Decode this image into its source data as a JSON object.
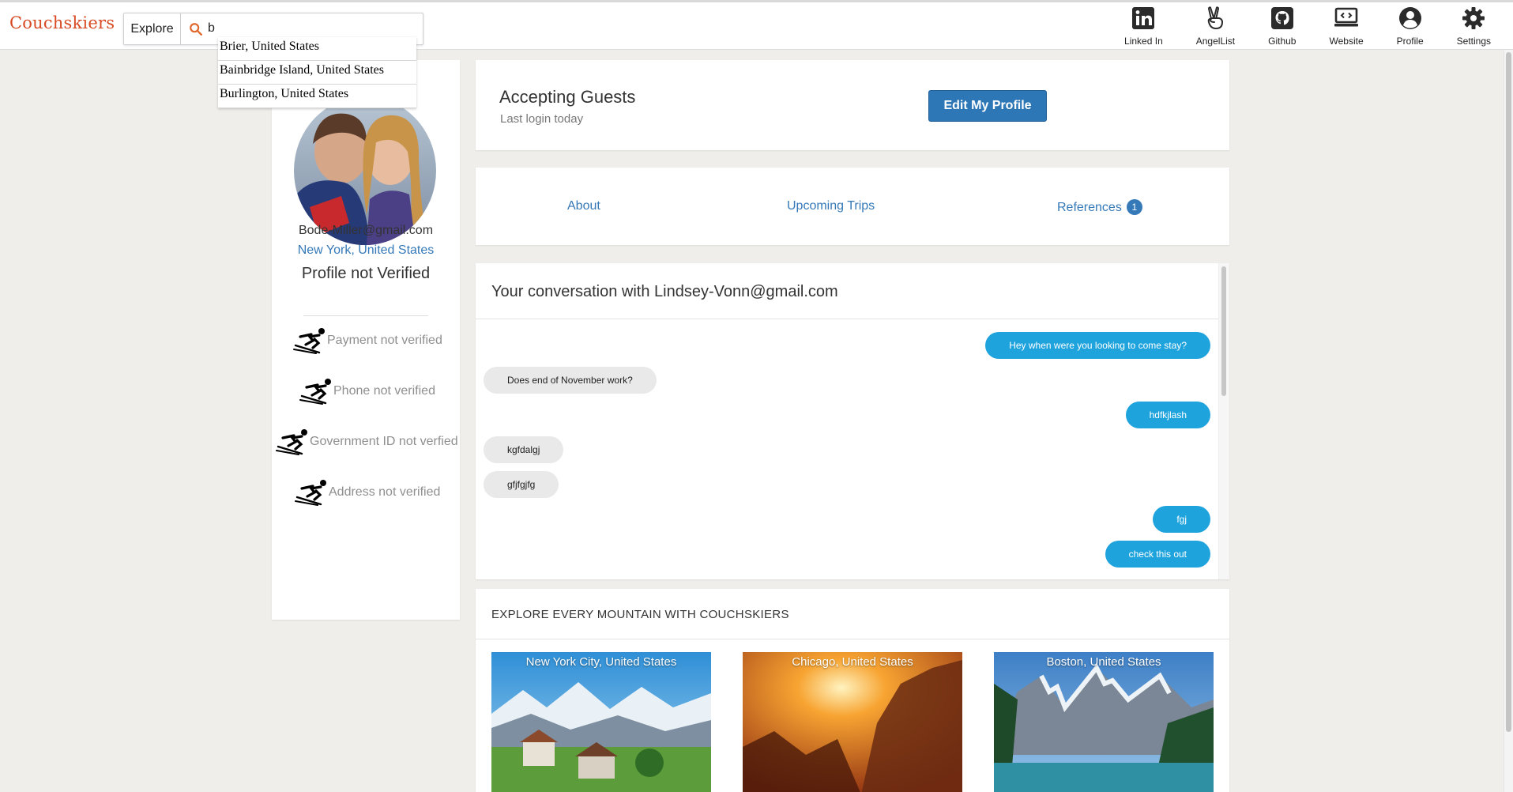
{
  "app": {
    "logo": "Couchskiers"
  },
  "search": {
    "explore_label": "Explore",
    "value": "b",
    "suggestions": [
      "Brier, United States",
      "Bainbridge Island, United States",
      "Burlington, United States"
    ]
  },
  "nav": {
    "items": [
      {
        "label": "Linked In",
        "icon": "linkedin-icon"
      },
      {
        "label": "AngelList",
        "icon": "angellist-icon"
      },
      {
        "label": "Github",
        "icon": "github-icon"
      },
      {
        "label": "Website",
        "icon": "website-icon"
      },
      {
        "label": "Profile",
        "icon": "profile-icon"
      },
      {
        "label": "Settings",
        "icon": "gear-icon"
      }
    ]
  },
  "profile": {
    "email": "Bode-Miller@gmail.com",
    "location": "New York, United States",
    "verification_status": "Profile not Verified",
    "verifications": [
      "Payment not verified",
      "Phone not verified",
      "Government ID not verfied",
      "Address not verified"
    ]
  },
  "status": {
    "title": "Accepting Guests",
    "subtitle": "Last login today",
    "edit_button": "Edit My Profile"
  },
  "tabs": {
    "about": "About",
    "upcoming": "Upcoming Trips",
    "references": "References",
    "references_count": "1"
  },
  "conversation": {
    "title": "Your conversation with Lindsey-Vonn@gmail.com",
    "messages": [
      {
        "from": "me",
        "text": "Hey when were you looking to come stay?"
      },
      {
        "from": "them",
        "text": "Does end of November work?"
      },
      {
        "from": "me",
        "text": "hdfkjlash"
      },
      {
        "from": "them",
        "text": "kgfdalgj"
      },
      {
        "from": "them",
        "text": "gfjfgjfg"
      },
      {
        "from": "me",
        "text": "fgj"
      },
      {
        "from": "me",
        "text": "check this out"
      }
    ]
  },
  "explore": {
    "title": "EXPLORE EVERY MOUNTAIN WITH COUCHSKIERS",
    "cities": [
      "New York City, United States",
      "Chicago, United States",
      "Boston, United States"
    ]
  },
  "colors": {
    "brand": "#d84a24",
    "link": "#3579b8",
    "primary_button": "#2e77b7",
    "outgoing_bubble": "#1ea3dd",
    "incoming_bubble": "#e9e9e9",
    "page_background": "#efeeea"
  }
}
